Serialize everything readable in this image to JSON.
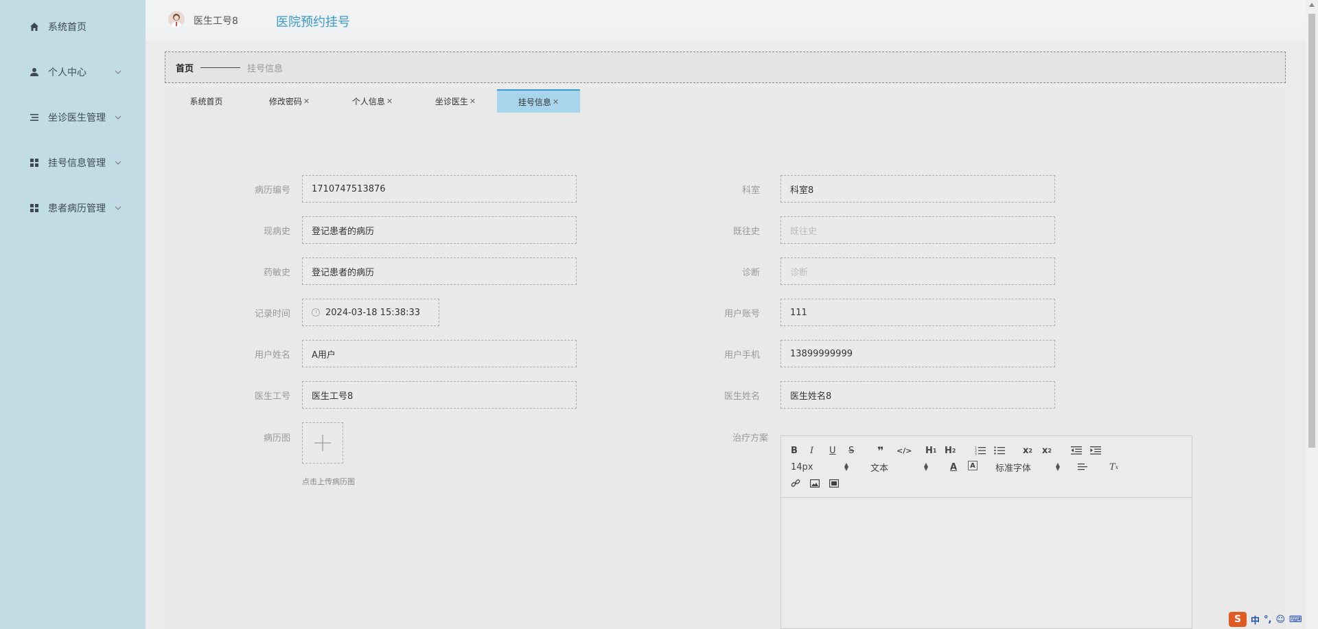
{
  "sidebar": {
    "items": [
      {
        "label": "系统首页",
        "icon": "home-icon",
        "has_arrow": false
      },
      {
        "label": "个人中心",
        "icon": "user-icon",
        "has_arrow": true
      },
      {
        "label": "坐诊医生管理",
        "icon": "list-icon",
        "has_arrow": true
      },
      {
        "label": "挂号信息管理",
        "icon": "grid-icon",
        "has_arrow": true
      },
      {
        "label": "患者病历管理",
        "icon": "grid-icon",
        "has_arrow": true
      }
    ]
  },
  "header": {
    "user": "医生工号8",
    "title": "医院预约挂号"
  },
  "breadcrumb": {
    "home": "首页",
    "current": "挂号信息"
  },
  "tabs": [
    {
      "label": "系统首页",
      "closable": false,
      "active": false
    },
    {
      "label": "修改密码",
      "closable": true,
      "active": false
    },
    {
      "label": "个人信息",
      "closable": true,
      "active": false
    },
    {
      "label": "坐诊医生",
      "closable": true,
      "active": false
    },
    {
      "label": "挂号信息",
      "closable": true,
      "active": true
    }
  ],
  "form": {
    "record_no": {
      "label": "病历编号",
      "value": "1710747513876"
    },
    "department": {
      "label": "科室",
      "value": "科室8"
    },
    "present_history": {
      "label": "现病史",
      "value": "登记患者的病历"
    },
    "past_history": {
      "label": "既往史",
      "value": "",
      "placeholder": "既往史"
    },
    "allergy_history": {
      "label": "药敏史",
      "value": "登记患者的病历"
    },
    "diagnosis": {
      "label": "诊断",
      "value": "",
      "placeholder": "诊断"
    },
    "record_time": {
      "label": "记录时间",
      "value": "2024-03-18 15:38:33"
    },
    "user_account": {
      "label": "用户账号",
      "value": "111"
    },
    "user_name": {
      "label": "用户姓名",
      "value": "A用户"
    },
    "user_phone": {
      "label": "用户手机",
      "value": "13899999999"
    },
    "doctor_id": {
      "label": "医生工号",
      "value": "医生工号8"
    },
    "doctor_name": {
      "label": "医生姓名",
      "value": "医生姓名8"
    },
    "record_image": {
      "label": "病历图",
      "hint": "点击上传病历图"
    },
    "treatment_plan": {
      "label": "治疗方案"
    }
  },
  "editor": {
    "font_size": "14px",
    "format": "文本",
    "font_family": "标准字体"
  },
  "ime": {
    "lang": "中",
    "punct": "°,"
  }
}
